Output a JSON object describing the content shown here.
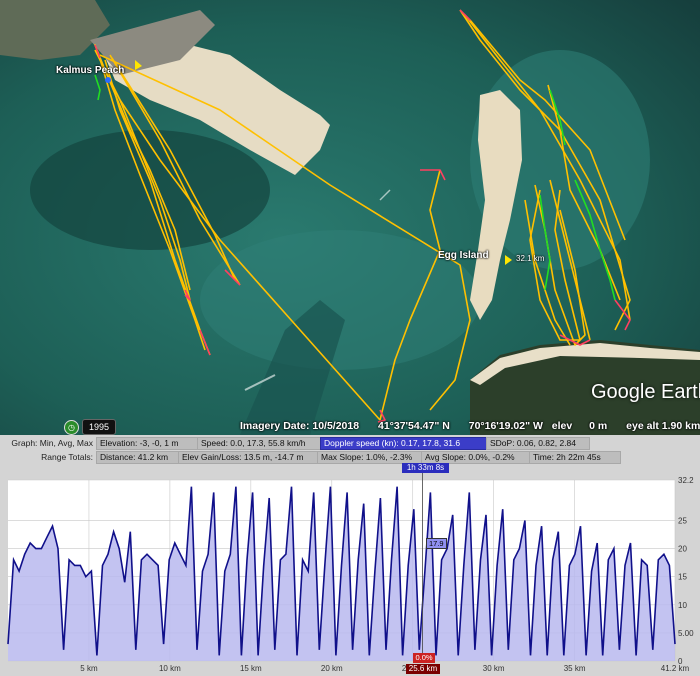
{
  "map": {
    "place_labels": [
      "Kalmus Peach",
      "Egg Island"
    ],
    "distance_tag": "32.1 km",
    "imagery_date": "Imagery Date: 10/5/2018",
    "latitude": "41°37'54.47\" N",
    "longitude": "70°16'19.02\" W",
    "elev_label": "elev",
    "elev_value": "0 m",
    "eye_alt": "eye alt  1.90 km",
    "brand": "Google Earth",
    "year": "1995",
    "colors": {
      "track_fast": "#ffc000",
      "track_slow": "#ff4060",
      "track_mid": "#22dd22",
      "water": "#1f6b63"
    }
  },
  "stats": {
    "graph_label": "Graph: Min, Avg, Max",
    "totals_label": "Range Totals:",
    "elevation": "Elevation: -3, -0, 1 m",
    "speed": "Speed: 0.0, 17.3, 55.8 km/h",
    "doppler": "Doppler speed (kn): 0.17, 17.8, 31.6",
    "sdop": "SDoP: 0.06, 0.82, 2.84",
    "distance": "Distance: 41.2 km",
    "elev_gain": "Elev Gain/Loss: 13.5 m, -14.7 m",
    "max_slope": "Max Slope: 1.0%, -2.3%",
    "avg_slope": "Avg Slope: 0.0%, -0.2%",
    "time": "Time: 2h 22m 45s"
  },
  "cursor": {
    "time": "1h 33m 8s",
    "value": "17.9",
    "distance": "25.6 km",
    "slope": "0.0%"
  },
  "chart_data": {
    "type": "area",
    "series": [
      {
        "name": "Doppler speed (kn)",
        "values": [
          3,
          18,
          16,
          19,
          21,
          20,
          20,
          22,
          24,
          20,
          2,
          18,
          17,
          17,
          15,
          16,
          1,
          17,
          19,
          23,
          20,
          14,
          23,
          2,
          18,
          19,
          18,
          17,
          3,
          18,
          21,
          19,
          17,
          31,
          2,
          16,
          19,
          30,
          1,
          16,
          19,
          31,
          1,
          18,
          30,
          1,
          17,
          29,
          2,
          18,
          19,
          31,
          1,
          18,
          16,
          30,
          2,
          17,
          31,
          1,
          17,
          30,
          2,
          18,
          28,
          1,
          16,
          29,
          2,
          18,
          31,
          1,
          17,
          27,
          2,
          16,
          30,
          1,
          18,
          20,
          26,
          1,
          17,
          30,
          2,
          18,
          26,
          1,
          17,
          27,
          2,
          18,
          20,
          25,
          1,
          17,
          24,
          1,
          18,
          23,
          1,
          17,
          19,
          24,
          1,
          16,
          21,
          1,
          18,
          20,
          2,
          17,
          21,
          1,
          18,
          17,
          2,
          18,
          19,
          17,
          3
        ]
      }
    ],
    "x_ticks": [
      "5 km",
      "10 km",
      "15 km",
      "20 km",
      "25 km",
      "30 km",
      "35 km",
      "41.2 km"
    ],
    "y_ticks": [
      "0",
      "5.00",
      "10",
      "15",
      "20",
      "25",
      "32.2"
    ],
    "xlim": [
      0,
      41.2
    ],
    "ylim": [
      0,
      32.2
    ],
    "grid": true
  }
}
